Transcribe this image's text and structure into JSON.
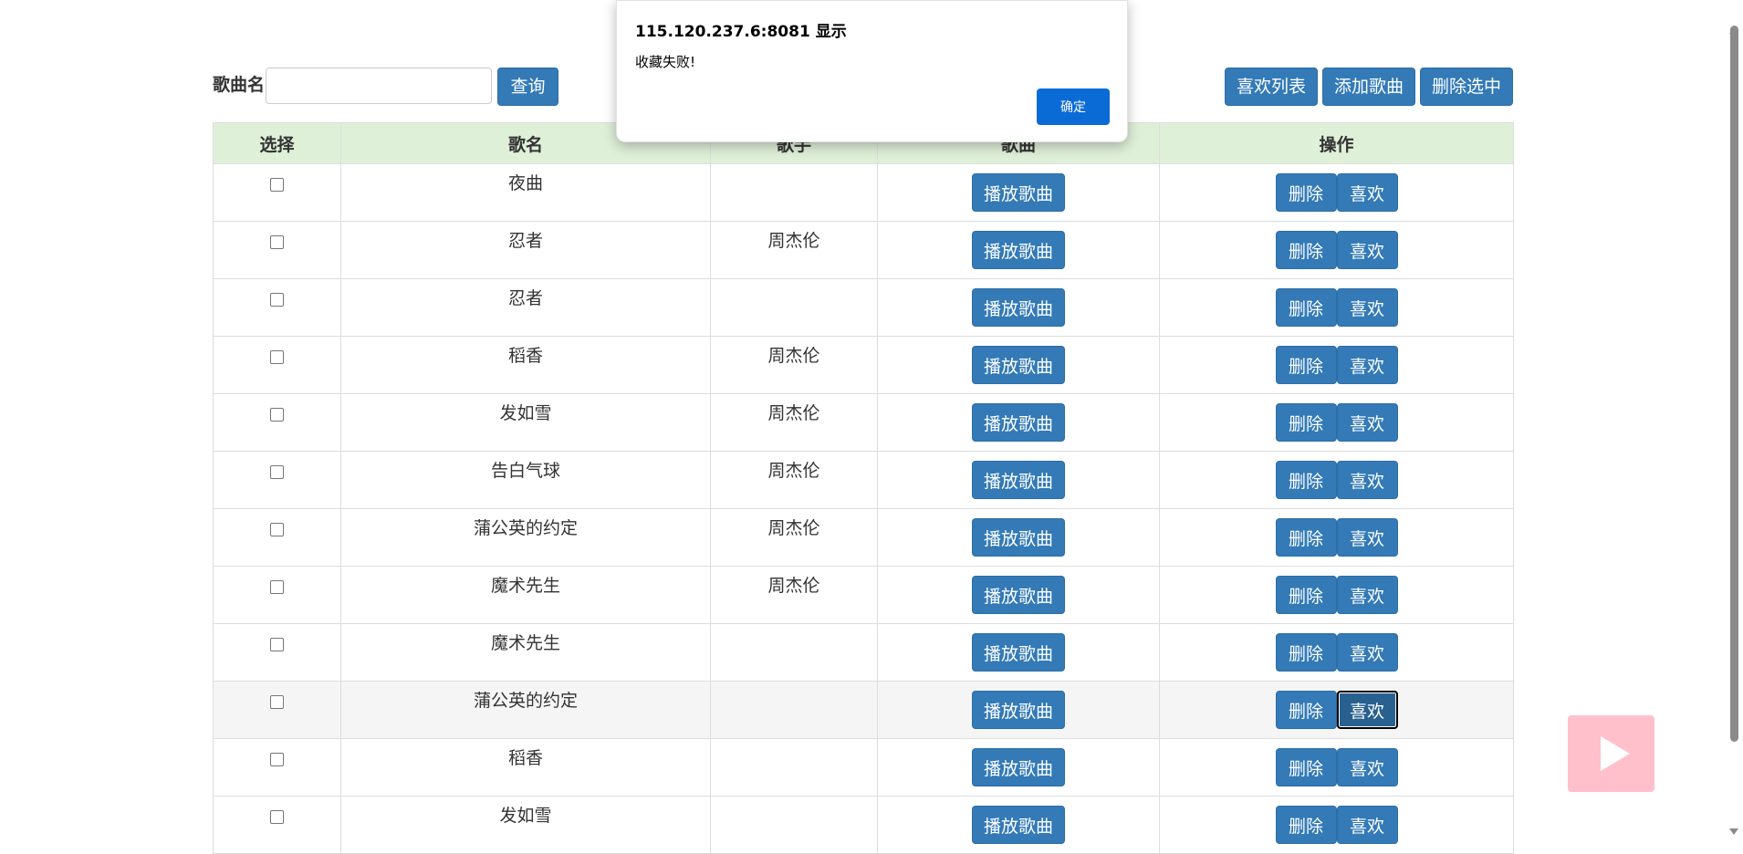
{
  "toolbar": {
    "search_label": "歌曲名",
    "search_value": "",
    "query_label": "查询",
    "fav_list_label": "喜欢列表",
    "add_label": "添加歌曲",
    "delete_selected_label": "删除选中"
  },
  "table": {
    "headers": [
      "选择",
      "歌名",
      "歌手",
      "歌曲",
      "操作"
    ],
    "play_label": "播放歌曲",
    "delete_label": "删除",
    "like_label": "喜欢",
    "rows": [
      {
        "name": "夜曲",
        "singer": "",
        "checked": false
      },
      {
        "name": "忍者",
        "singer": "周杰伦",
        "checked": false
      },
      {
        "name": "忍者",
        "singer": "",
        "checked": false
      },
      {
        "name": "稻香",
        "singer": "周杰伦",
        "checked": false
      },
      {
        "name": "发如雪",
        "singer": "周杰伦",
        "checked": false
      },
      {
        "name": "告白气球",
        "singer": "周杰伦",
        "checked": false
      },
      {
        "name": "蒲公英的约定",
        "singer": "周杰伦",
        "checked": false
      },
      {
        "name": "魔术先生",
        "singer": "周杰伦",
        "checked": false
      },
      {
        "name": "魔术先生",
        "singer": "",
        "checked": false
      },
      {
        "name": "蒲公英的约定",
        "singer": "",
        "checked": false,
        "hover": true,
        "like_focused": true
      },
      {
        "name": "稻香",
        "singer": "",
        "checked": false
      },
      {
        "name": "发如雪",
        "singer": "",
        "checked": false
      }
    ]
  },
  "dialog": {
    "title": "115.120.237.6:8081 显示",
    "message": "收藏失败!",
    "ok_label": "确定"
  },
  "colors": {
    "primary": "#337ab7",
    "header_bg": "#dff0d8",
    "dialog_ok": "#0b6bd6",
    "play_widget": "#ffc0cb"
  },
  "icons": {
    "play_widget": "play-icon"
  }
}
